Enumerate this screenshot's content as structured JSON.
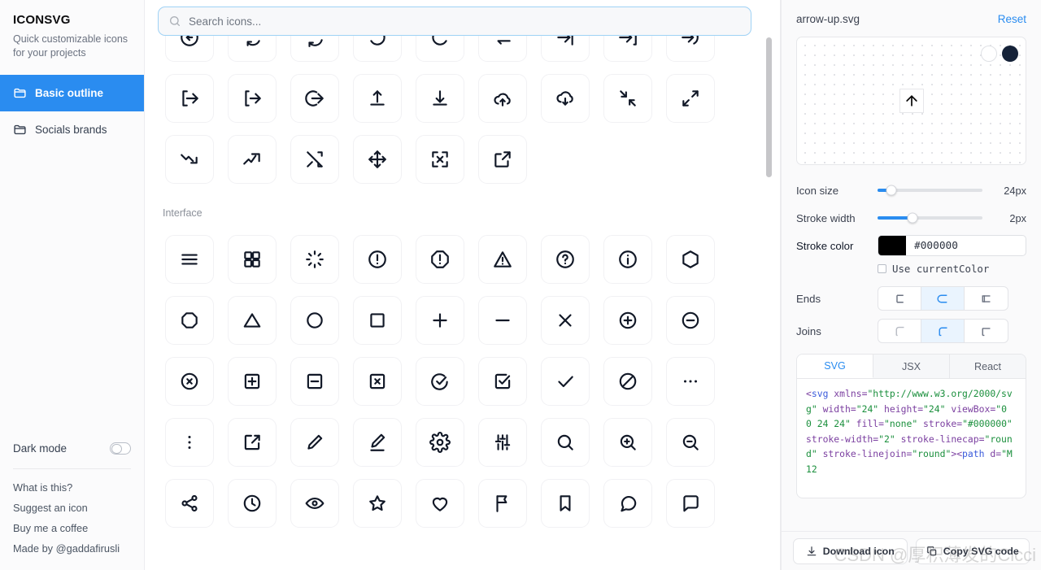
{
  "sidebar": {
    "brand": "ICONSVG",
    "tagline": "Quick customizable icons for your projects",
    "nav": [
      {
        "label": "Basic outline",
        "icon": "folder-icon",
        "active": true
      },
      {
        "label": "Socials brands",
        "icon": "folder-icon",
        "active": false
      }
    ],
    "dark_mode_label": "Dark mode",
    "links": [
      "What is this?",
      "Suggest an icon",
      "Buy me a coffee",
      "Made by @gaddafirusli"
    ]
  },
  "search": {
    "placeholder": "Search icons...",
    "value": "",
    "icon": "search-icon"
  },
  "grid": {
    "sections": [
      {
        "label": "",
        "icons": [
          "arrow-left-circle",
          "refresh-ccw",
          "refresh-cw-double",
          "rotate-ccw",
          "rotate-cw",
          "repeat",
          "log-in-right",
          "log-in-bracket",
          "arrow-into-arc",
          "log-out",
          "log-out-alt",
          "arrow-right-circle",
          "upload",
          "download",
          "cloud-upload",
          "cloud-download",
          "minimize",
          "maximize",
          "trend-down",
          "trend-up",
          "shuffle",
          "move",
          "expand-corners",
          "external-link"
        ]
      },
      {
        "label": "Interface",
        "icons": [
          "menu",
          "grid",
          "loader",
          "alert-circle",
          "alert-octagon",
          "alert-triangle",
          "help-circle",
          "info",
          "hexagon",
          "octagon",
          "triangle",
          "circle",
          "square",
          "plus",
          "minus",
          "x",
          "plus-circle",
          "minus-circle",
          "x-circle",
          "plus-square",
          "minus-square",
          "x-square",
          "check-circle",
          "check-square",
          "check",
          "slash",
          "more-horizontal",
          "more-vertical",
          "edit-square",
          "pencil",
          "edit-underline",
          "settings",
          "sliders",
          "search",
          "zoom-in",
          "zoom-out",
          "share",
          "clock",
          "eye",
          "star",
          "heart",
          "flag",
          "bookmark",
          "message-circle",
          "message-square"
        ]
      }
    ]
  },
  "panel": {
    "filename": "arrow-up.svg",
    "reset_label": "Reset",
    "preview_icon": "arrow-up",
    "swatches": [
      {
        "name": "light-swatch",
        "color": "#ffffff"
      },
      {
        "name": "dark-swatch",
        "color": "#152238"
      }
    ],
    "controls": [
      {
        "label": "Icon size",
        "value": "24px",
        "percent": 13
      },
      {
        "label": "Stroke width",
        "value": "2px",
        "percent": 33
      }
    ],
    "stroke_color": {
      "label": "Stroke color",
      "value": "#000000",
      "chip": "#000000"
    },
    "current_color": {
      "label": "Use currentColor",
      "checked": false
    },
    "ends": {
      "label": "Ends",
      "options": [
        "butt",
        "round",
        "square"
      ],
      "selected_index": 1
    },
    "joins": {
      "label": "Joins",
      "options": [
        "miter",
        "round",
        "bevel"
      ],
      "selected_index": 1
    },
    "code": {
      "tabs": [
        "SVG",
        "JSX",
        "React"
      ],
      "active_tab_index": 0,
      "tokens": [
        {
          "t": "<",
          "c": "tk"
        },
        {
          "t": "svg",
          "c": "tp"
        },
        {
          "t": " ",
          "c": "tk"
        },
        {
          "t": "xmlns",
          "c": "ta"
        },
        {
          "t": "=",
          "c": "tk"
        },
        {
          "t": "\"http://www.w3.org/2000/svg\"",
          "c": "tv"
        },
        {
          "t": " ",
          "c": "tk"
        },
        {
          "t": "width",
          "c": "ta"
        },
        {
          "t": "=",
          "c": "tk"
        },
        {
          "t": "\"24\"",
          "c": "tv"
        },
        {
          "t": " ",
          "c": "tk"
        },
        {
          "t": "height",
          "c": "ta"
        },
        {
          "t": "=",
          "c": "tk"
        },
        {
          "t": "\"24\"",
          "c": "tv"
        },
        {
          "t": " ",
          "c": "tk"
        },
        {
          "t": "viewBox",
          "c": "ta"
        },
        {
          "t": "=",
          "c": "tk"
        },
        {
          "t": "\"0 0 24 24\"",
          "c": "tv"
        },
        {
          "t": " ",
          "c": "tk"
        },
        {
          "t": "fill",
          "c": "ta"
        },
        {
          "t": "=",
          "c": "tk"
        },
        {
          "t": "\"none\"",
          "c": "tv"
        },
        {
          "t": " ",
          "c": "tk"
        },
        {
          "t": "stroke",
          "c": "ta"
        },
        {
          "t": "=",
          "c": "tk"
        },
        {
          "t": "\"#000000\"",
          "c": "tv"
        },
        {
          "t": " ",
          "c": "tk"
        },
        {
          "t": "stroke-width",
          "c": "ta"
        },
        {
          "t": "=",
          "c": "tk"
        },
        {
          "t": "\"2\"",
          "c": "tv"
        },
        {
          "t": " ",
          "c": "tk"
        },
        {
          "t": "stroke-linecap",
          "c": "ta"
        },
        {
          "t": "=",
          "c": "tk"
        },
        {
          "t": "\"round\"",
          "c": "tv"
        },
        {
          "t": " ",
          "c": "tk"
        },
        {
          "t": "stroke-linejoin",
          "c": "ta"
        },
        {
          "t": "=",
          "c": "tk"
        },
        {
          "t": "\"round\"",
          "c": "tv"
        },
        {
          "t": ">",
          "c": "tk"
        },
        {
          "t": "<",
          "c": "tk"
        },
        {
          "t": "path",
          "c": "tp"
        },
        {
          "t": " ",
          "c": "tk"
        },
        {
          "t": "d",
          "c": "ta"
        },
        {
          "t": "=",
          "c": "tk"
        },
        {
          "t": "\"M12",
          "c": "tv"
        }
      ]
    },
    "actions": [
      {
        "label": "Download icon",
        "icon": "download-icon"
      },
      {
        "label": "Copy SVG code",
        "icon": "copy-icon"
      }
    ]
  },
  "watermark": "CSDN @厚积薄发的Cicci",
  "colors": {
    "accent": "#2a8cf0",
    "sidebar_bg": "#fbfbfc",
    "panel_bg": "#fafafb",
    "border": "#ececef"
  }
}
